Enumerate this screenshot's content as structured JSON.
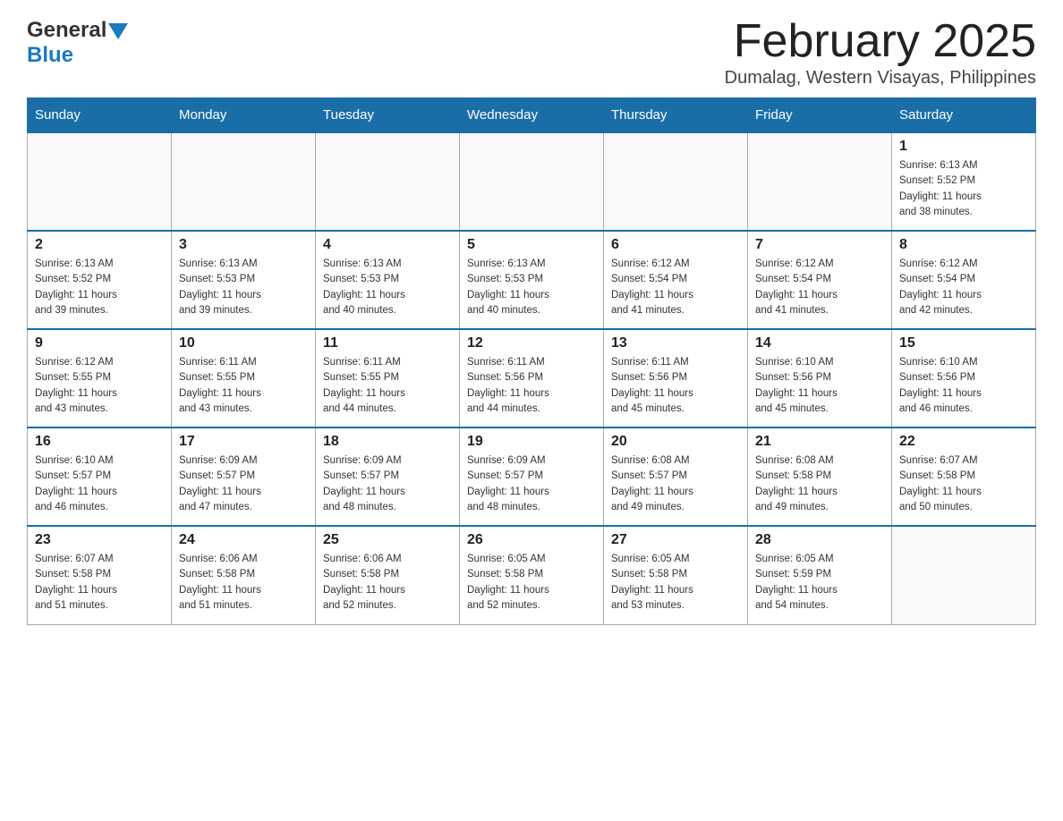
{
  "header": {
    "logo_general": "General",
    "logo_blue": "Blue",
    "month_title": "February 2025",
    "location": "Dumalag, Western Visayas, Philippines"
  },
  "days_of_week": [
    "Sunday",
    "Monday",
    "Tuesday",
    "Wednesday",
    "Thursday",
    "Friday",
    "Saturday"
  ],
  "weeks": [
    [
      {
        "day": "",
        "info": ""
      },
      {
        "day": "",
        "info": ""
      },
      {
        "day": "",
        "info": ""
      },
      {
        "day": "",
        "info": ""
      },
      {
        "day": "",
        "info": ""
      },
      {
        "day": "",
        "info": ""
      },
      {
        "day": "1",
        "info": "Sunrise: 6:13 AM\nSunset: 5:52 PM\nDaylight: 11 hours\nand 38 minutes."
      }
    ],
    [
      {
        "day": "2",
        "info": "Sunrise: 6:13 AM\nSunset: 5:52 PM\nDaylight: 11 hours\nand 39 minutes."
      },
      {
        "day": "3",
        "info": "Sunrise: 6:13 AM\nSunset: 5:53 PM\nDaylight: 11 hours\nand 39 minutes."
      },
      {
        "day": "4",
        "info": "Sunrise: 6:13 AM\nSunset: 5:53 PM\nDaylight: 11 hours\nand 40 minutes."
      },
      {
        "day": "5",
        "info": "Sunrise: 6:13 AM\nSunset: 5:53 PM\nDaylight: 11 hours\nand 40 minutes."
      },
      {
        "day": "6",
        "info": "Sunrise: 6:12 AM\nSunset: 5:54 PM\nDaylight: 11 hours\nand 41 minutes."
      },
      {
        "day": "7",
        "info": "Sunrise: 6:12 AM\nSunset: 5:54 PM\nDaylight: 11 hours\nand 41 minutes."
      },
      {
        "day": "8",
        "info": "Sunrise: 6:12 AM\nSunset: 5:54 PM\nDaylight: 11 hours\nand 42 minutes."
      }
    ],
    [
      {
        "day": "9",
        "info": "Sunrise: 6:12 AM\nSunset: 5:55 PM\nDaylight: 11 hours\nand 43 minutes."
      },
      {
        "day": "10",
        "info": "Sunrise: 6:11 AM\nSunset: 5:55 PM\nDaylight: 11 hours\nand 43 minutes."
      },
      {
        "day": "11",
        "info": "Sunrise: 6:11 AM\nSunset: 5:55 PM\nDaylight: 11 hours\nand 44 minutes."
      },
      {
        "day": "12",
        "info": "Sunrise: 6:11 AM\nSunset: 5:56 PM\nDaylight: 11 hours\nand 44 minutes."
      },
      {
        "day": "13",
        "info": "Sunrise: 6:11 AM\nSunset: 5:56 PM\nDaylight: 11 hours\nand 45 minutes."
      },
      {
        "day": "14",
        "info": "Sunrise: 6:10 AM\nSunset: 5:56 PM\nDaylight: 11 hours\nand 45 minutes."
      },
      {
        "day": "15",
        "info": "Sunrise: 6:10 AM\nSunset: 5:56 PM\nDaylight: 11 hours\nand 46 minutes."
      }
    ],
    [
      {
        "day": "16",
        "info": "Sunrise: 6:10 AM\nSunset: 5:57 PM\nDaylight: 11 hours\nand 46 minutes."
      },
      {
        "day": "17",
        "info": "Sunrise: 6:09 AM\nSunset: 5:57 PM\nDaylight: 11 hours\nand 47 minutes."
      },
      {
        "day": "18",
        "info": "Sunrise: 6:09 AM\nSunset: 5:57 PM\nDaylight: 11 hours\nand 48 minutes."
      },
      {
        "day": "19",
        "info": "Sunrise: 6:09 AM\nSunset: 5:57 PM\nDaylight: 11 hours\nand 48 minutes."
      },
      {
        "day": "20",
        "info": "Sunrise: 6:08 AM\nSunset: 5:57 PM\nDaylight: 11 hours\nand 49 minutes."
      },
      {
        "day": "21",
        "info": "Sunrise: 6:08 AM\nSunset: 5:58 PM\nDaylight: 11 hours\nand 49 minutes."
      },
      {
        "day": "22",
        "info": "Sunrise: 6:07 AM\nSunset: 5:58 PM\nDaylight: 11 hours\nand 50 minutes."
      }
    ],
    [
      {
        "day": "23",
        "info": "Sunrise: 6:07 AM\nSunset: 5:58 PM\nDaylight: 11 hours\nand 51 minutes."
      },
      {
        "day": "24",
        "info": "Sunrise: 6:06 AM\nSunset: 5:58 PM\nDaylight: 11 hours\nand 51 minutes."
      },
      {
        "day": "25",
        "info": "Sunrise: 6:06 AM\nSunset: 5:58 PM\nDaylight: 11 hours\nand 52 minutes."
      },
      {
        "day": "26",
        "info": "Sunrise: 6:05 AM\nSunset: 5:58 PM\nDaylight: 11 hours\nand 52 minutes."
      },
      {
        "day": "27",
        "info": "Sunrise: 6:05 AM\nSunset: 5:58 PM\nDaylight: 11 hours\nand 53 minutes."
      },
      {
        "day": "28",
        "info": "Sunrise: 6:05 AM\nSunset: 5:59 PM\nDaylight: 11 hours\nand 54 minutes."
      },
      {
        "day": "",
        "info": ""
      }
    ]
  ],
  "colors": {
    "header_bg": "#1a6ea8",
    "header_text": "#ffffff",
    "border": "#aaaaaa",
    "day_number": "#222222",
    "day_info": "#333333",
    "empty_bg": "#f9f9f9"
  }
}
